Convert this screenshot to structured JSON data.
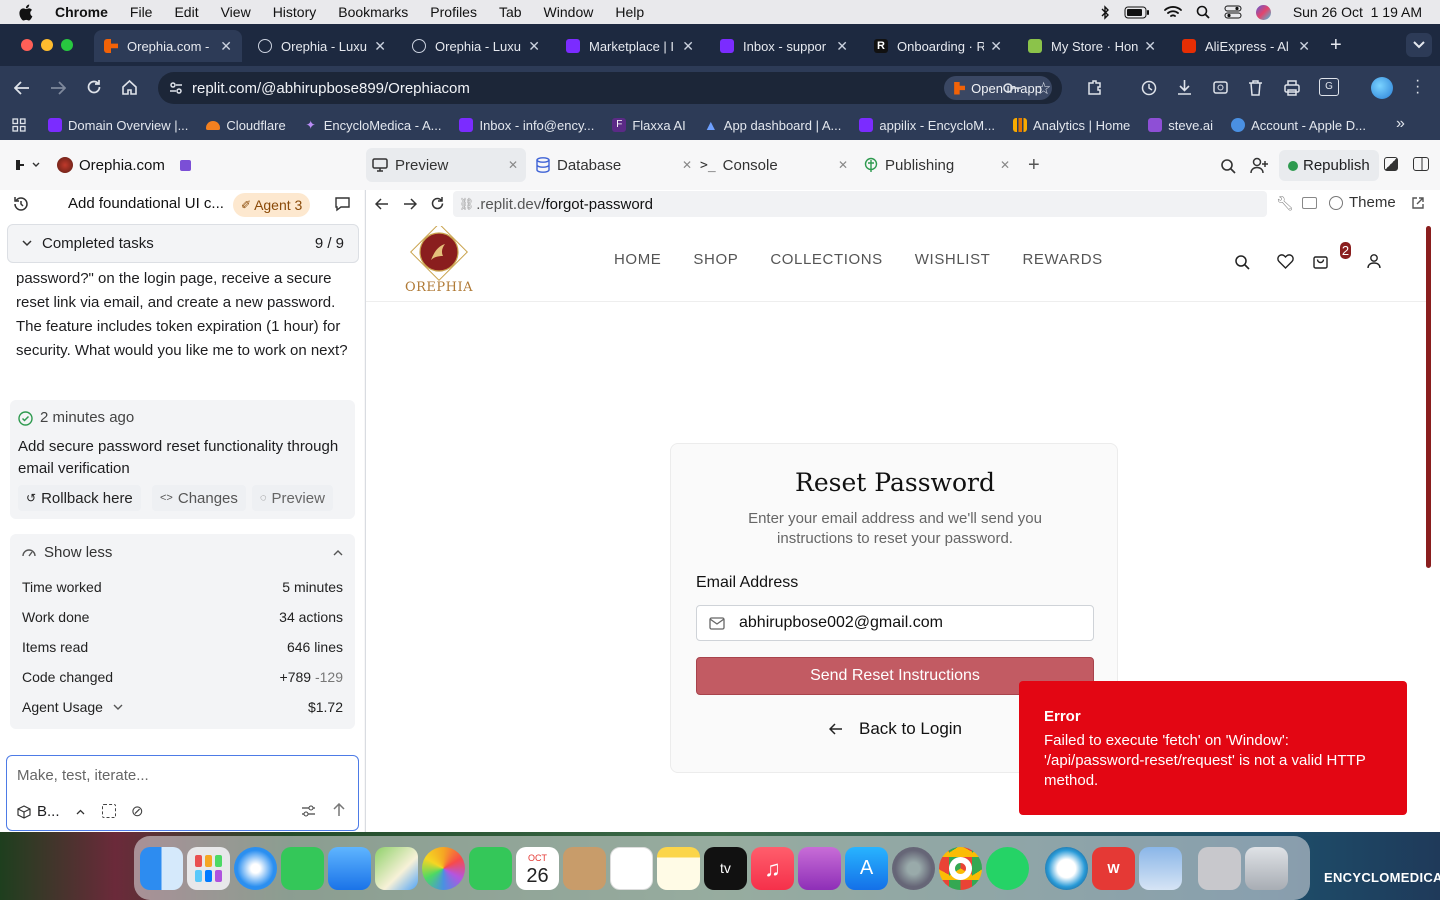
{
  "menubar": {
    "apple": "",
    "app": "Chrome",
    "items": [
      "File",
      "Edit",
      "View",
      "History",
      "Bookmarks",
      "Profiles",
      "Tab",
      "Window",
      "Help"
    ],
    "clock": "Sun 26 Oct  1 19 AM"
  },
  "tabs": [
    {
      "label": "Orephia.com -",
      "color": "#f26207",
      "active": true
    },
    {
      "label": "Orephia - Luxu",
      "color": "#9aa3b2"
    },
    {
      "label": "Orephia - Luxu",
      "color": "#9aa3b2"
    },
    {
      "label": "Marketplace | I",
      "color": "#7b2cff"
    },
    {
      "label": "Inbox - suppor",
      "color": "#7b2cff"
    },
    {
      "label": "Onboarding · R",
      "color": "#111111"
    },
    {
      "label": "My Store · Hon",
      "color": "#8bc34a"
    },
    {
      "label": "AliExpress - Al",
      "color": "#e62e04"
    }
  ],
  "omnibox": {
    "url": "replit.com/@abhirupbose899/Orephiacom",
    "open_in_app": "Open in app"
  },
  "bookmarks": [
    {
      "label": "Domain Overview |...",
      "color": "#7b2cff"
    },
    {
      "label": "Cloudflare",
      "color": "#f38020"
    },
    {
      "label": "EncycloMedica - A...",
      "color": "#9b5cf6"
    },
    {
      "label": "Inbox - info@ency...",
      "color": "#7b2cff"
    },
    {
      "label": "Flaxxa AI",
      "color": "#5b2a86"
    },
    {
      "label": "App dashboard | A...",
      "color": "#3b6cf6"
    },
    {
      "label": "appilix - EncycloM...",
      "color": "#7b2cff"
    },
    {
      "label": "Analytics | Home",
      "color": "#f9ab00"
    },
    {
      "label": "steve.ai",
      "color": "#8e4fd6"
    },
    {
      "label": "Account - Apple D...",
      "color": "#4a90e2"
    }
  ],
  "replit": {
    "project": "Orephia.com",
    "tabs": [
      {
        "label": "Preview"
      },
      {
        "label": "Database"
      },
      {
        "label": "Console"
      },
      {
        "label": "Publishing"
      }
    ],
    "republish": "Republish",
    "agent": {
      "thread_title": "Add foundational UI c...",
      "agent_badge": "Agent 3",
      "completed_label": "Completed tasks",
      "completed_count": "9 / 9",
      "message": "password?\" on the login page, receive a secure reset link via email, and create a new password. The feature includes token expiration (1 hour) for security. What would you like me to work on next?",
      "checkpoint_time": "2 minutes ago",
      "checkpoint_title": "Add secure password reset functionality through email verification",
      "rollback": "Rollback here",
      "changes": "Changes",
      "preview": "Preview",
      "show_less": "Show less",
      "stats": [
        {
          "label": "Time worked",
          "value": "5 minutes"
        },
        {
          "label": "Work done",
          "value": "34 actions"
        },
        {
          "label": "Items read",
          "value": "646 lines"
        }
      ],
      "code_changed_label": "Code changed",
      "added": "+789",
      "removed": "-129",
      "usage_label": "Agent Usage",
      "usage_value": "$1.72",
      "input_placeholder": "Make, test, iterate...",
      "build_mode": "B..."
    },
    "preview_bar": {
      "url_host": ".replit.dev",
      "url_path": "/forgot-password",
      "theme": "Theme"
    }
  },
  "site": {
    "brand": "OREPHIA",
    "nav": [
      "HOME",
      "SHOP",
      "COLLECTIONS",
      "WISHLIST",
      "REWARDS"
    ],
    "cart_count": "2",
    "card": {
      "title": "Reset Password",
      "subtitle": "Enter your email address and we'll send you instructions to reset your password.",
      "email_label": "Email Address",
      "email_value": "abhirupbose002@gmail.com",
      "submit": "Send Reset Instructions",
      "back": "Back to Login"
    },
    "toast": {
      "title": "Error",
      "message": "Failed to execute 'fetch' on 'Window': '/api/password-reset/request' is not a valid HTTP method."
    }
  },
  "dock": {
    "calendar_month": "OCT",
    "calendar_day": "26",
    "wallpaper_label": "ENCYCLOMEDICA"
  }
}
